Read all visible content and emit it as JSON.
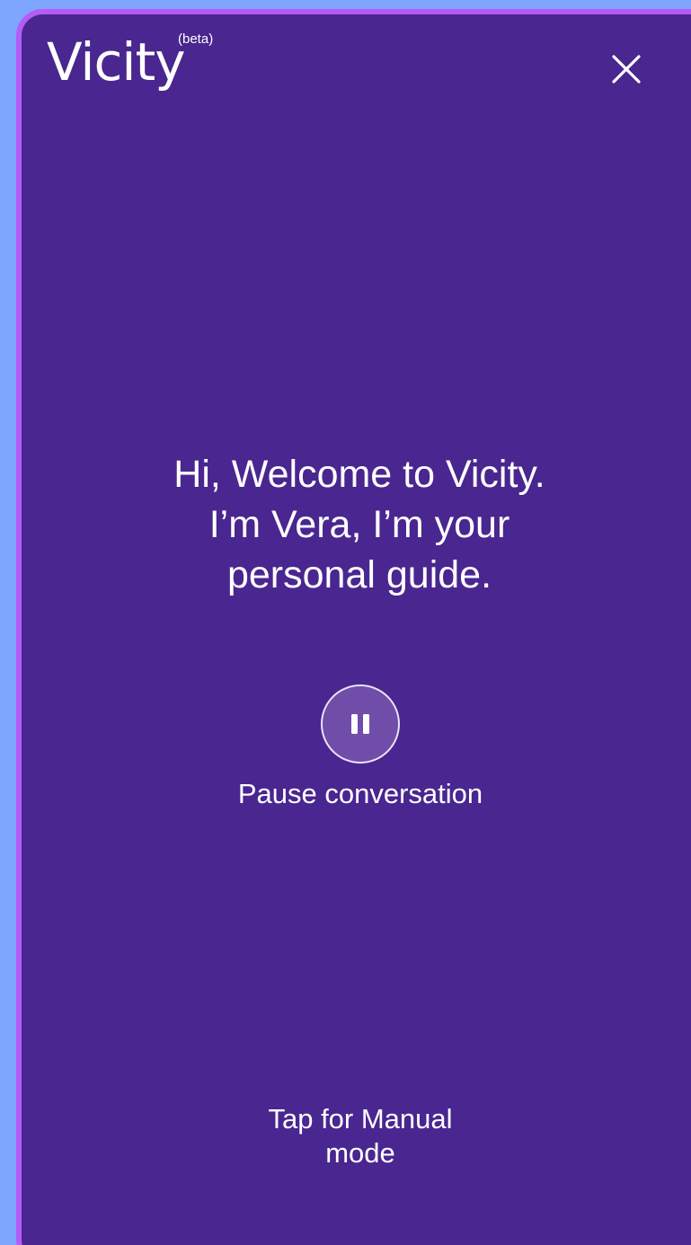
{
  "header": {
    "logo_text": "Vicity",
    "beta_badge": "(beta)",
    "close_icon": "close-icon"
  },
  "main": {
    "welcome_lines": [
      "Hi, Welcome to Vicity.",
      "I’m Vera, I’m your",
      "personal guide."
    ],
    "pause_icon": "pause-icon",
    "pause_label": "Pause conversation",
    "manual_mode_label_line_1": "Tap for Manual",
    "manual_mode_label_line_2": "mode"
  },
  "colors": {
    "page_background": "#7fa6ff",
    "panel_background": "#4a2690",
    "panel_border": "#b45cf5",
    "pause_button_background": "#6f4da9",
    "text": "#ffffff"
  }
}
